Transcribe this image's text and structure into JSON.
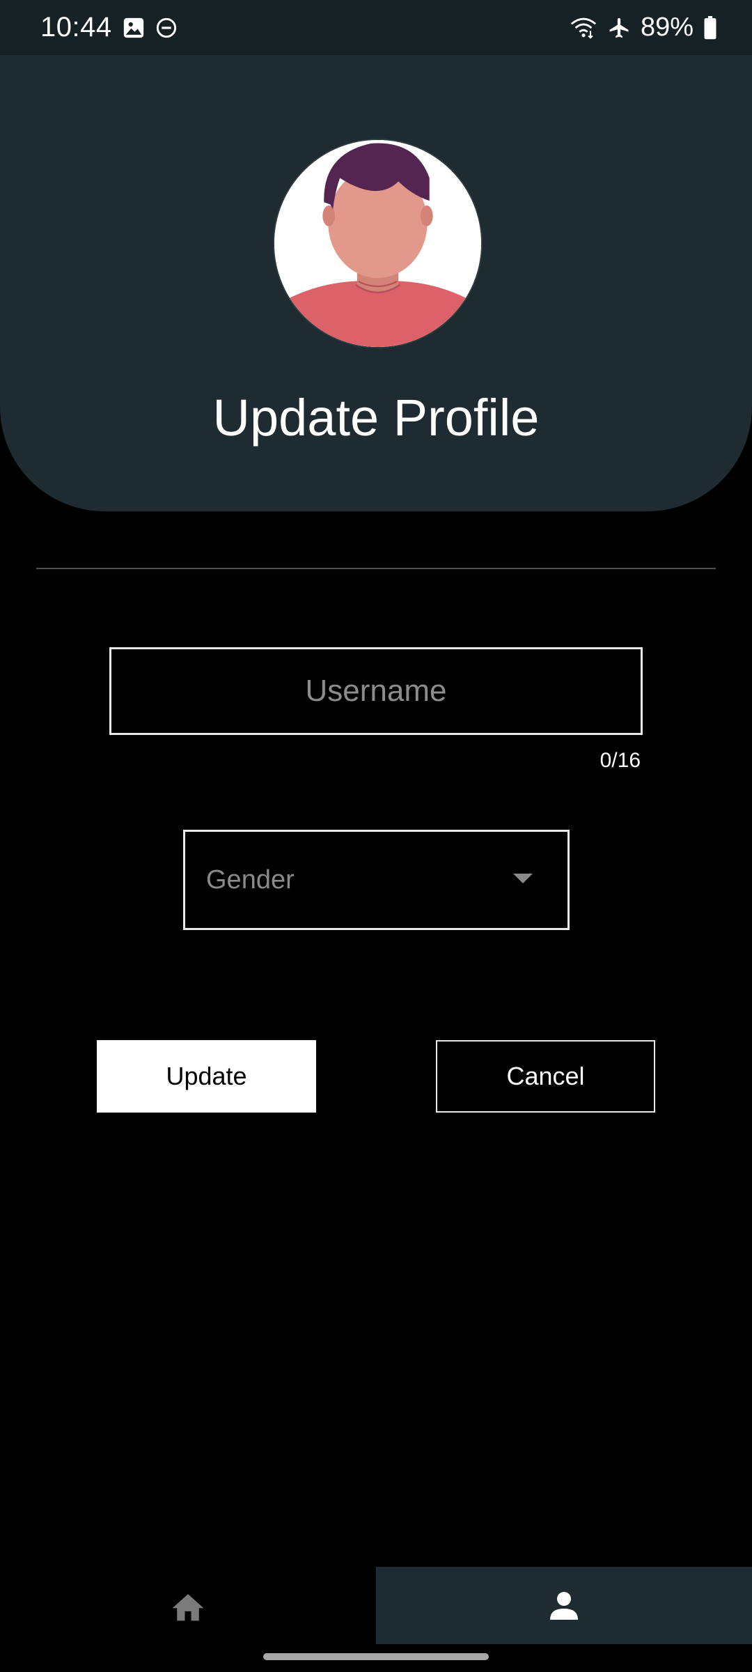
{
  "status_bar": {
    "time": "10:44",
    "battery": "89%",
    "icons": [
      "image-icon",
      "do-not-disturb-icon",
      "wifi-icon",
      "airplane-icon",
      "battery-icon"
    ]
  },
  "header": {
    "title": "Update Profile",
    "avatar": "avatar-illustration"
  },
  "form": {
    "username": {
      "value": "",
      "placeholder": "Username",
      "counter": "0/16"
    },
    "gender": {
      "placeholder": "Gender"
    }
  },
  "buttons": {
    "update": "Update",
    "cancel": "Cancel"
  },
  "bottom_nav": {
    "items": [
      {
        "icon": "home-icon",
        "selected": false
      },
      {
        "icon": "person-icon",
        "selected": true
      }
    ]
  },
  "colors": {
    "header_bg": "#1e2b31",
    "status_bar_bg": "#162125",
    "page_bg": "#000000",
    "button_primary_bg": "#ffffff",
    "nav_selected_bg": "#1e2b31"
  }
}
